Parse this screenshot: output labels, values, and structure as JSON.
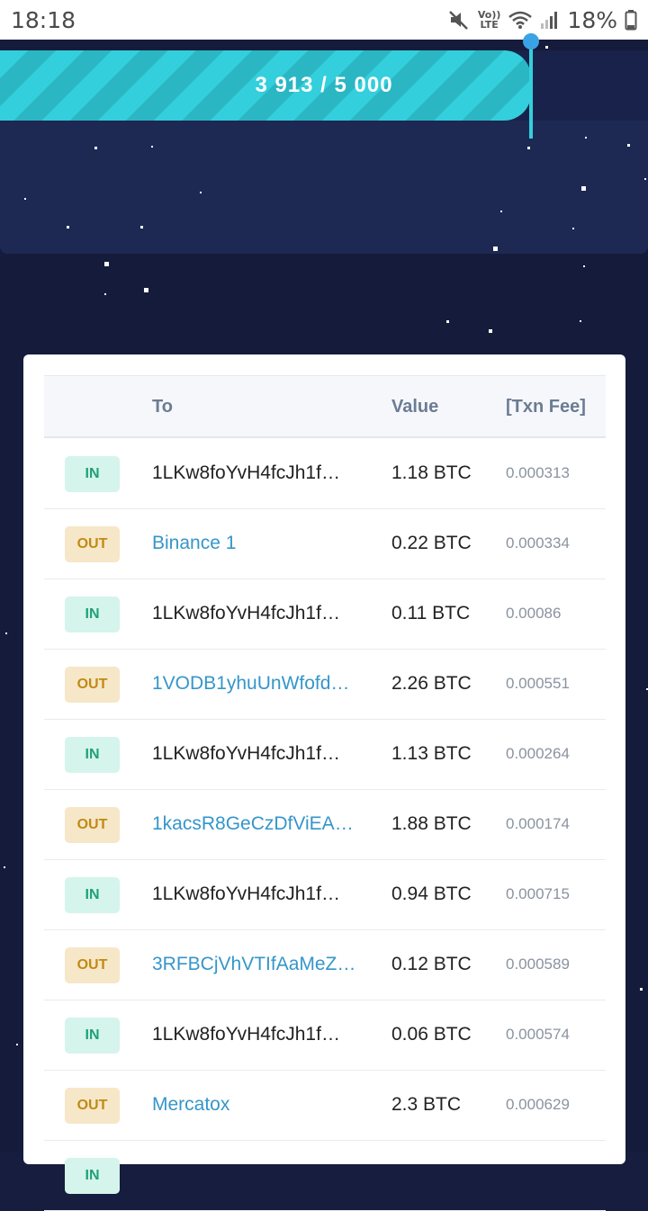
{
  "status_bar": {
    "time": "18:18",
    "network_label": "Vo)) LTE",
    "battery": "18%",
    "icons": [
      "mute-icon",
      "volte-icon",
      "wifi-icon",
      "signal-icon",
      "battery-icon"
    ]
  },
  "progress": {
    "label": "3 913 / 5 000",
    "current": 3913,
    "total": 5000,
    "fill_fraction": 0.78,
    "colors": {
      "stripe_light": "#33cfdc",
      "stripe_dark": "#2bb6c4",
      "marker": "#3aa3e6"
    }
  },
  "table": {
    "headers": {
      "col1": "",
      "to": "To",
      "value": "Value",
      "fee": "[Txn Fee]"
    },
    "rows": [
      {
        "direction": "IN",
        "to": "1LKw8foYvH4fcJh1f…",
        "to_is_link": false,
        "value": "1.18 BTC",
        "fee": "0.000313"
      },
      {
        "direction": "OUT",
        "to": "Binance 1",
        "to_is_link": true,
        "value": "0.22 BTC",
        "fee": "0.000334"
      },
      {
        "direction": "IN",
        "to": "1LKw8foYvH4fcJh1f…",
        "to_is_link": false,
        "value": "0.11 BTC",
        "fee": "0.00086"
      },
      {
        "direction": "OUT",
        "to": "1VODB1yhuUnWfofd…",
        "to_is_link": true,
        "value": "2.26 BTC",
        "fee": "0.000551"
      },
      {
        "direction": "IN",
        "to": "1LKw8foYvH4fcJh1f…",
        "to_is_link": false,
        "value": "1.13 BTC",
        "fee": "0.000264"
      },
      {
        "direction": "OUT",
        "to": "1kacsR8GeCzDfViEA…",
        "to_is_link": true,
        "value": "1.88 BTC",
        "fee": "0.000174"
      },
      {
        "direction": "IN",
        "to": "1LKw8foYvH4fcJh1f…",
        "to_is_link": false,
        "value": "0.94 BTC",
        "fee": "0.000715"
      },
      {
        "direction": "OUT",
        "to": "3RFBCjVhVTIfAaMeZ…",
        "to_is_link": true,
        "value": "0.12 BTC",
        "fee": "0.000589"
      },
      {
        "direction": "IN",
        "to": "1LKw8foYvH4fcJh1f…",
        "to_is_link": false,
        "value": "0.06 BTC",
        "fee": "0.000574"
      },
      {
        "direction": "OUT",
        "to": "Mercatox",
        "to_is_link": true,
        "value": "2.3 BTC",
        "fee": "0.000629"
      },
      {
        "direction": "IN",
        "to": "",
        "to_is_link": false,
        "value": "",
        "fee": ""
      }
    ]
  },
  "colors": {
    "background": "#151b3a",
    "panel": "#1d2853",
    "in_badge_bg": "#d5f4ec",
    "in_badge_text": "#1fa07a",
    "out_badge_bg": "#f6e7c8",
    "out_badge_text": "#c08a14",
    "link": "#3596c9"
  }
}
